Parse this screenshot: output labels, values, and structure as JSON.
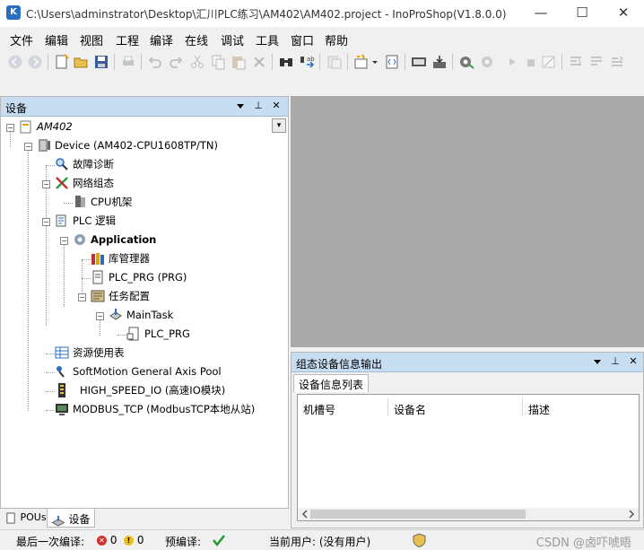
{
  "window": {
    "title": "C:\\Users\\adminstrator\\Desktop\\汇川PLC练习\\AM402\\AM402.project - InoProShop(V1.8.0.0)",
    "app_icon_glyph": "K",
    "minimize": "—",
    "maximize": "☐",
    "close": "✕"
  },
  "menu": [
    "文件",
    "编辑",
    "视图",
    "工程",
    "编译",
    "在线",
    "调试",
    "工具",
    "窗口",
    "帮助"
  ],
  "toolbar": {
    "icons": [
      "back-icon",
      "forward-icon",
      "new-project-icon",
      "open-icon",
      "save-icon",
      "print-icon",
      "undo-icon",
      "redo-icon",
      "cut-icon",
      "copy-icon",
      "paste-icon",
      "delete-icon",
      "find-icon",
      "replace-icon",
      "bookmark-icon",
      "build-icon",
      "dropdown-icon",
      "generate-code-icon",
      "download-icon",
      "login-icon",
      "logout-icon",
      "run-icon",
      "stop-icon",
      "reset-icon",
      "step-in-icon",
      "step-over-icon",
      "step-out-icon"
    ]
  },
  "device_panel": {
    "title": "设备",
    "pin_glyph": "⊥",
    "close_glyph": "✕",
    "dropdown_glyph": "▾",
    "tree": [
      {
        "label": "AM402",
        "italic": true
      },
      {
        "label": "Device (AM402-CPU1608TP/TN)"
      },
      {
        "label": "故障诊断"
      },
      {
        "label": "网络组态"
      },
      {
        "label": "CPU机架"
      },
      {
        "label": "PLC 逻辑"
      },
      {
        "label": "Application",
        "bold": true
      },
      {
        "label": "库管理器"
      },
      {
        "label": "PLC_PRG (PRG)"
      },
      {
        "label": "任务配置"
      },
      {
        "label": "MainTask"
      },
      {
        "label": "PLC_PRG"
      },
      {
        "label": "资源使用表"
      },
      {
        "label": "SoftMotion General Axis Pool"
      },
      {
        "label": "HIGH_SPEED_IO (高速IO模块)"
      },
      {
        "label": "MODBUS_TCP (ModbusTCP本地从站)"
      }
    ]
  },
  "bottom_tabs": [
    "POUs",
    "设备"
  ],
  "message_panel": {
    "title": "组态设备信息输出",
    "tab": "设备信息列表",
    "columns": [
      "机槽号",
      "设备名",
      "描述"
    ]
  },
  "status": {
    "last_compile_label": "最后一次编译:",
    "errors": "0",
    "warnings": "0",
    "precompile_label": "预编译:",
    "current_user": "当前用户: (没有用户)",
    "watermark": "CSDN @卤吓唬晤"
  }
}
